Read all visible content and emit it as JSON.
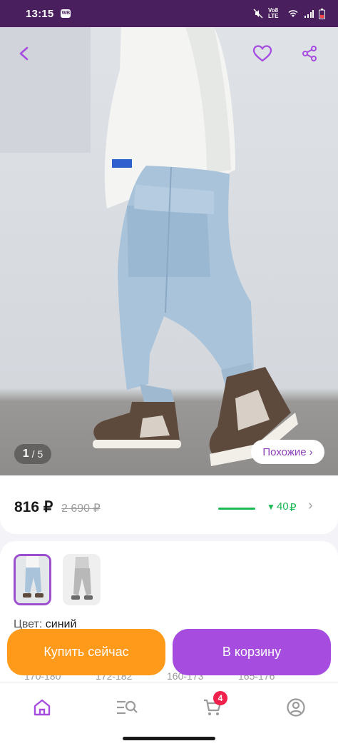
{
  "status_bar": {
    "time": "13:15",
    "app_badge": "WB",
    "network": "Vo8 LTE"
  },
  "gallery": {
    "current": "1",
    "separator": "/",
    "total": "5",
    "similar_label": "Похожие",
    "similar_chevron": "›"
  },
  "price": {
    "current": "816 ₽",
    "old": "2 690 ₽",
    "promo_value": "40",
    "promo_currency": "₽",
    "promo_arrow": "▼",
    "chevron": "›"
  },
  "variant": {
    "color_label": "Цвет:",
    "color_value": "синий",
    "sizes": [
      "170-180",
      "172-182",
      "160-173",
      "165-176"
    ]
  },
  "actions": {
    "buy_now": "Купить сейчас",
    "add_to_cart": "В корзину"
  },
  "nav": {
    "cart_count": "4"
  },
  "colors": {
    "status_bar": "#4a1f5e",
    "brand_purple": "#a64de0",
    "buy_orange": "#ff9a1b",
    "promo_green": "#1db954",
    "badge_red": "#f0214c"
  },
  "icons": [
    "back-arrow-icon",
    "heart-icon",
    "share-icon",
    "home-icon",
    "catalog-search-icon",
    "cart-icon",
    "profile-icon"
  ]
}
